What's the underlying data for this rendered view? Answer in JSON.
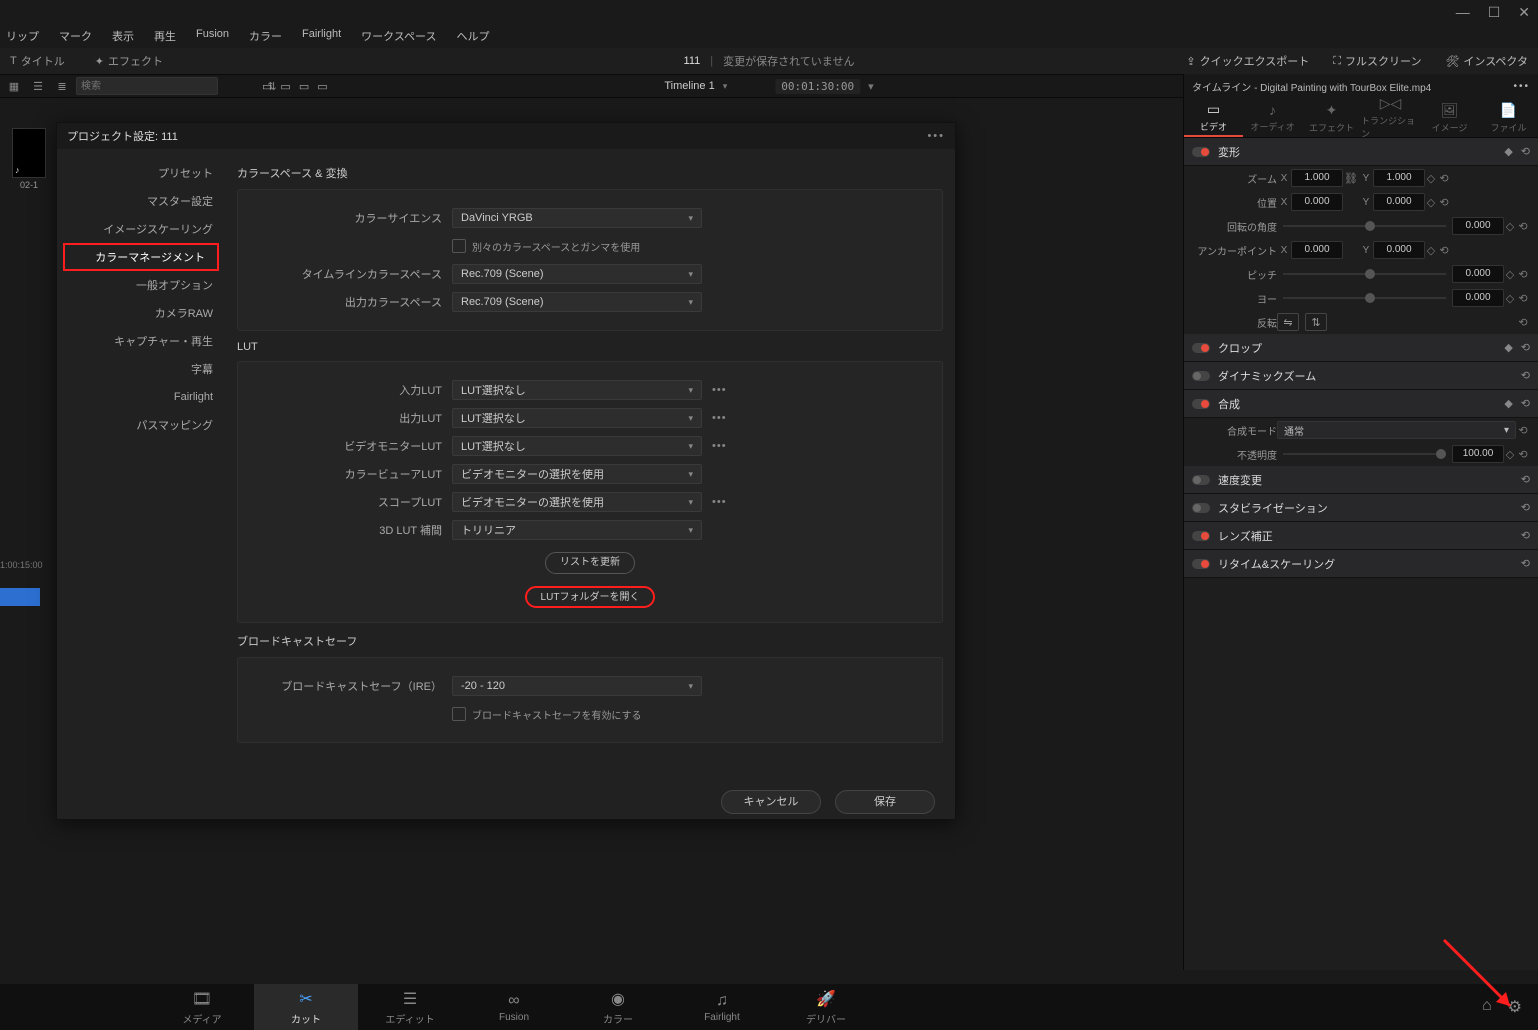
{
  "window": {
    "min": "—",
    "max": "☐",
    "close": "✕"
  },
  "menu": [
    "リップ",
    "マーク",
    "表示",
    "再生",
    "Fusion",
    "カラー",
    "Fairlight",
    "ワークスペース",
    "ヘルプ"
  ],
  "toolbar": {
    "title_btn": "タイトル",
    "effects_btn": "エフェクト",
    "project_name": "111",
    "unsaved": "変更が保存されていません",
    "quick_export": "クイックエクスポート",
    "fullscreen": "フルスクリーン",
    "inspector": "インスペクタ"
  },
  "tbar2": {
    "search_ph": "検索",
    "timeline": "Timeline 1",
    "tc": "00:01:30:00"
  },
  "leftstrip": {
    "cap": "02-1"
  },
  "modal": {
    "title": "プロジェクト設定: 111",
    "nav": [
      "プリセット",
      "マスター設定",
      "イメージスケーリング",
      "カラーマネージメント",
      "一般オプション",
      "カメラRAW",
      "キャプチャー・再生",
      "字幕",
      "Fairlight",
      "パスマッピング"
    ],
    "active_idx": 3,
    "g1": {
      "title": "カラースペース & 変換",
      "cs_label": "カラーサイエンス",
      "cs_val": "DaVinci YRGB",
      "sep_label": "別々のカラースペースとガンマを使用",
      "tl_label": "タイムラインカラースペース",
      "tl_val": "Rec.709 (Scene)",
      "out_label": "出力カラースペース",
      "out_val": "Rec.709 (Scene)"
    },
    "g2": {
      "title": "LUT",
      "in_label": "入力LUT",
      "in_val": "LUT選択なし",
      "out_label": "出力LUT",
      "out_val": "LUT選択なし",
      "vm_label": "ビデオモニターLUT",
      "vm_val": "LUT選択なし",
      "cv_label": "カラービューアLUT",
      "cv_val": "ビデオモニターの選択を使用",
      "sc_label": "スコープLUT",
      "sc_val": "ビデオモニターの選択を使用",
      "i3_label": "3D LUT 補間",
      "i3_val": "トリリニア",
      "refresh": "リストを更新",
      "open": "LUTフォルダーを開く"
    },
    "g3": {
      "title": "ブロードキャストセーフ",
      "ire_label": "ブロードキャストセーフ（IRE）",
      "ire_val": "-20 - 120",
      "en_label": "ブロードキャストセーフを有効にする"
    },
    "cancel": "キャンセル",
    "save": "保存"
  },
  "inspector_panel": {
    "hdr": "タイムライン - Digital Painting with TourBox Elite.mp4",
    "tabs": [
      "ビデオ",
      "オーディオ",
      "エフェクト",
      "トランジション",
      "イメージ",
      "ファイル"
    ],
    "transform": {
      "title": "変形",
      "zoom": "ズーム",
      "zx": "1.000",
      "zy": "1.000",
      "pos": "位置",
      "px": "0.000",
      "py": "0.000",
      "rot": "回転の角度",
      "rv": "0.000",
      "anc": "アンカーポイント",
      "ax": "0.000",
      "ay": "0.000",
      "pit": "ピッチ",
      "pv": "0.000",
      "yaw": "ヨー",
      "yv": "0.000",
      "flip": "反転"
    },
    "crop": "クロップ",
    "dz": "ダイナミックズーム",
    "comp": {
      "title": "合成",
      "mode_l": "合成モード",
      "mode_v": "通常",
      "op_l": "不透明度",
      "op_v": "100.00"
    },
    "speed": "速度変更",
    "stab": "スタビライゼーション",
    "lens": "レンズ補正",
    "retime": "リタイム&スケーリング"
  },
  "tl": {
    "tick": "1:00:15:00"
  },
  "pages": [
    "メディア",
    "カット",
    "エディット",
    "Fusion",
    "カラー",
    "Fairlight",
    "デリバー"
  ]
}
